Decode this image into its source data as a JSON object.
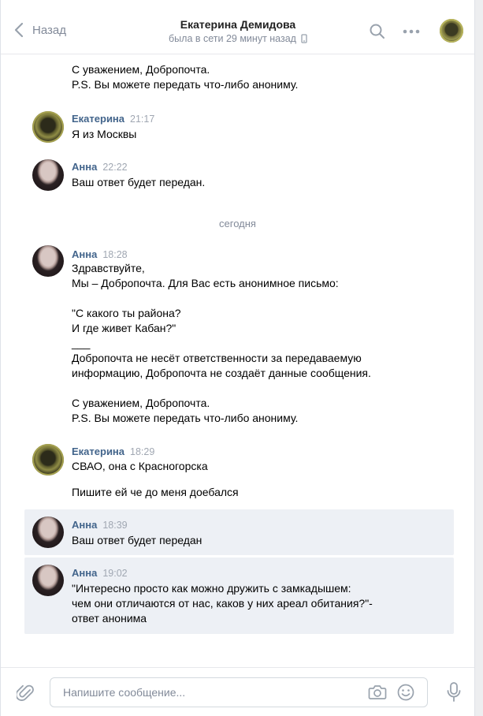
{
  "header": {
    "back_label": "Назад",
    "title": "Екатерина Демидова",
    "subtitle": "была в сети 29 минут назад"
  },
  "feed": {
    "top_continuation": {
      "lines": [
        "С уважением, Добропочта.",
        "P.S. Вы можете передать что-либо анониму."
      ]
    },
    "day_divider": "сегодня",
    "messages": [
      {
        "author": "Екатерина",
        "time": "21:17",
        "lines": [
          "Я из Москвы"
        ]
      },
      {
        "author": "Анна",
        "time": "22:22",
        "lines": [
          "Ваш ответ будет передан."
        ]
      },
      {
        "author": "Анна",
        "time": "18:28",
        "lines": [
          "Здравствуйте,",
          "Мы – Добропочта. Для Вас есть анонимное письмо:",
          "",
          "\"С какого ты района?",
          "И где живет Кабан?\"",
          "___",
          "Добропочта не несёт ответственности за передаваемую",
          "информацию, Добропочта не создаёт данные сообщения.",
          "",
          "С уважением, Добропочта.",
          "P.S. Вы можете передать что-либо анониму."
        ]
      },
      {
        "author": "Екатерина",
        "time": "18:29",
        "lines": [
          "СВАО, она с Красногорска"
        ],
        "followup": "Пишите ей че до меня доебался"
      },
      {
        "author": "Анна",
        "time": "18:39",
        "lines": [
          "Ваш ответ будет передан"
        ]
      },
      {
        "author": "Анна",
        "time": "19:02",
        "lines": [
          "\"Интересно просто как можно дружить с замкадышем:",
          "чем они отличаются от нас, каков у них ареал обитания?\"-",
          "ответ анонима"
        ]
      }
    ]
  },
  "composer": {
    "placeholder": "Напишите сообщение..."
  },
  "colors": {
    "accent": "#42648b",
    "muted": "#828a99",
    "unread_bg": "#edf0f5"
  }
}
